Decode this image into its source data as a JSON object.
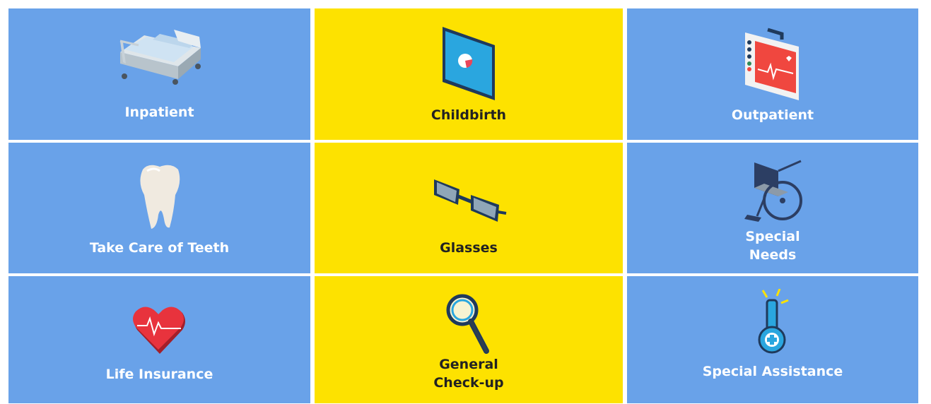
{
  "tiles": [
    {
      "name": "inpatient",
      "lines": [
        "Inpatient"
      ],
      "icon": "hospital-bed-icon",
      "color": "#69a2e9"
    },
    {
      "name": "childbirth",
      "lines": [
        "Childbirth"
      ],
      "icon": "ultrasound-monitor-icon",
      "color": "#fde200"
    },
    {
      "name": "outpatient",
      "lines": [
        "Outpatient"
      ],
      "icon": "medical-case-icon",
      "color": "#69a2e9"
    },
    {
      "name": "teeth",
      "lines": [
        "Take Care of Teeth"
      ],
      "icon": "tooth-icon",
      "color": "#69a2e9"
    },
    {
      "name": "glasses",
      "lines": [
        "Glasses"
      ],
      "icon": "glasses-icon",
      "color": "#fde200"
    },
    {
      "name": "special-needs",
      "lines": [
        "Special",
        "Needs"
      ],
      "icon": "wheelchair-icon",
      "color": "#69a2e9"
    },
    {
      "name": "life-insurance",
      "lines": [
        "Life Insurance"
      ],
      "icon": "heart-pulse-icon",
      "color": "#69a2e9"
    },
    {
      "name": "general-checkup",
      "lines": [
        "General",
        "Check-up"
      ],
      "icon": "magnifier-icon",
      "color": "#fde200"
    },
    {
      "name": "special-assistance",
      "lines": [
        "Special Assistance"
      ],
      "icon": "medical-thermometer-icon",
      "color": "#69a2e9"
    }
  ]
}
